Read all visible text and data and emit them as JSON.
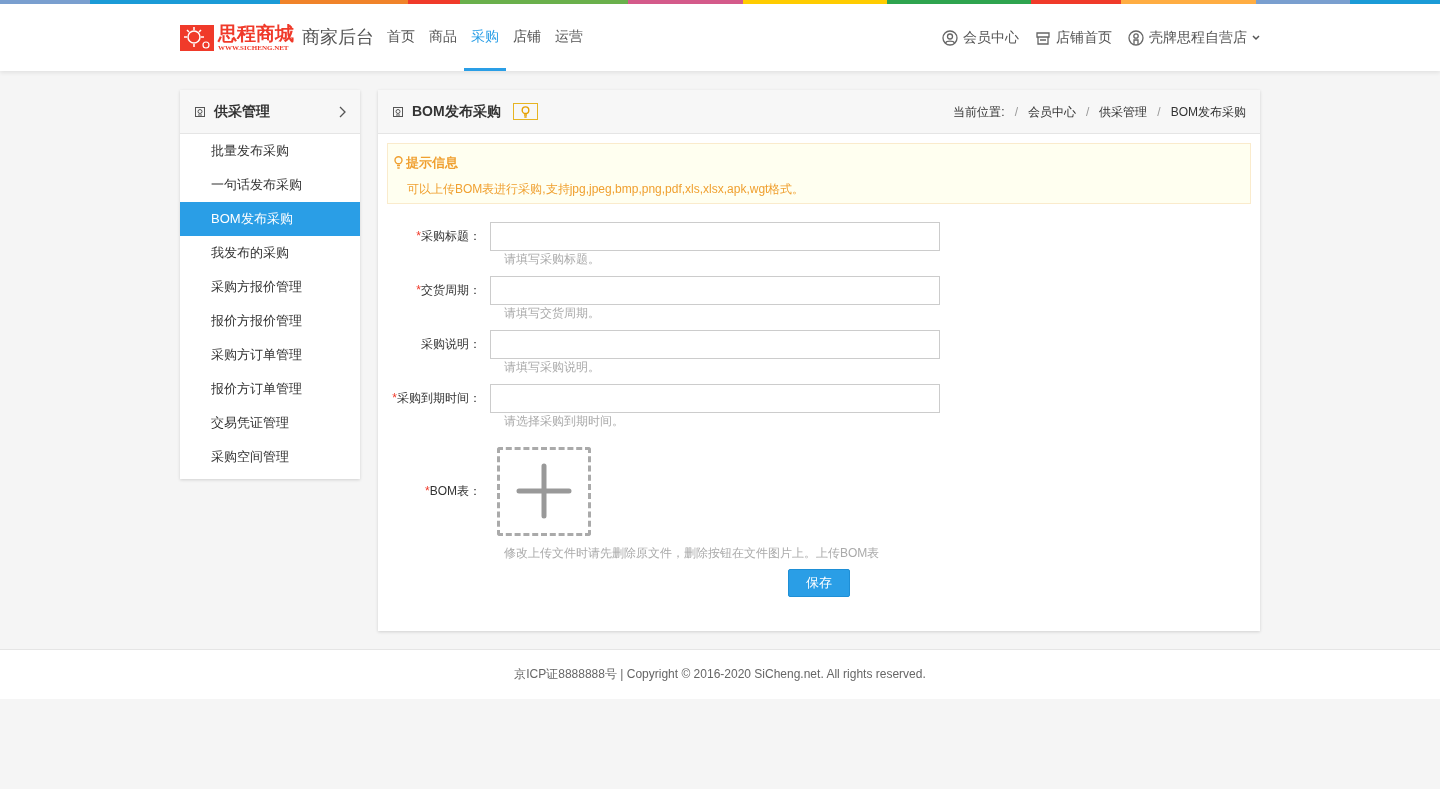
{
  "header": {
    "logo_text": "思程商城",
    "logo_subtext": "WWW.SICHENG.NET",
    "title": "商家后台",
    "nav": [
      {
        "label": "首页",
        "selected": false
      },
      {
        "label": "商品",
        "selected": false
      },
      {
        "label": "采购",
        "selected": true
      },
      {
        "label": "店铺",
        "selected": false
      },
      {
        "label": "运营",
        "selected": false
      }
    ],
    "links": [
      {
        "kind": "user",
        "label": "会员中心"
      },
      {
        "kind": "shop",
        "label": "店铺首页"
      },
      {
        "kind": "account",
        "label": "壳牌思程自营店"
      }
    ]
  },
  "sidebar": {
    "title": "供采管理",
    "items": [
      {
        "label": "批量发布采购",
        "selected": false
      },
      {
        "label": "一句话发布采购",
        "selected": false
      },
      {
        "label": "BOM发布采购",
        "selected": true
      },
      {
        "label": "我发布的采购",
        "selected": false
      },
      {
        "label": "采购方报价管理",
        "selected": false
      },
      {
        "label": "报价方报价管理",
        "selected": false
      },
      {
        "label": "采购方订单管理",
        "selected": false
      },
      {
        "label": "报价方订单管理",
        "selected": false
      },
      {
        "label": "交易凭证管理",
        "selected": false
      },
      {
        "label": "采购空间管理",
        "selected": false
      }
    ]
  },
  "panel": {
    "title": "BOM发布采购",
    "breadcrumb_label": "当前位置:",
    "breadcrumb": [
      {
        "separator": "/",
        "label": "会员中心"
      },
      {
        "separator": "/",
        "label": "供采管理"
      },
      {
        "separator": "/",
        "label": "BOM发布采购"
      }
    ],
    "notice": {
      "title": "提示信息",
      "text": "可以上传BOM表进行采购,支持jpg,jpeg,bmp,png,pdf,xls,xlsx,apk,wgt格式。"
    },
    "fields": [
      {
        "kind": "text",
        "label": "采购标题：",
        "required_mark": "*",
        "help": "请填写采购标题。"
      },
      {
        "kind": "text",
        "label": "交货周期：",
        "required_mark": "*",
        "help": "请填写交货周期。"
      },
      {
        "kind": "text",
        "label": "采购说明：",
        "help": "请填写采购说明。"
      },
      {
        "kind": "text",
        "label": "采购到期时间：",
        "required_mark": "*",
        "help": "请选择采购到期时间。"
      },
      {
        "kind": "upload",
        "label": "BOM表：",
        "required_mark": "*",
        "help": "修改上传文件时请先删除原文件，删除按钮在文件图片上。上传BOM表"
      }
    ],
    "save_button": "保存"
  },
  "footer": "京ICP证8888888号 | Copyright © 2016-2020 SiCheng.net. All rights reserved."
}
